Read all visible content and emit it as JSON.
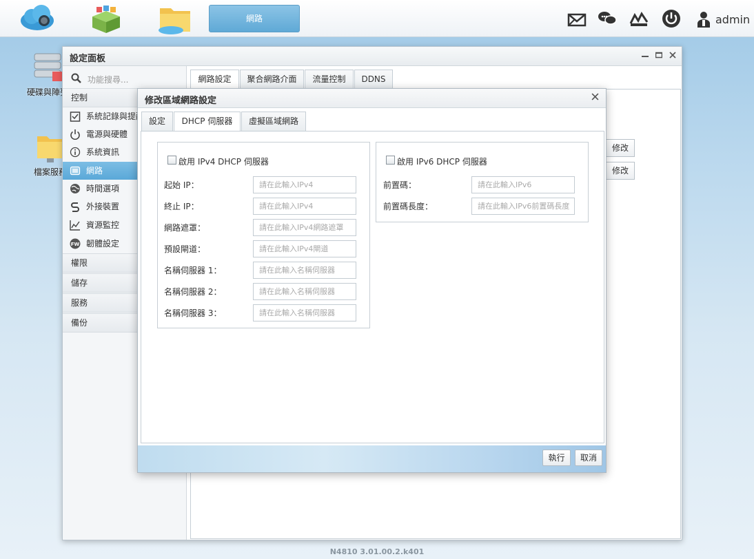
{
  "taskbar": {
    "active_app_label": "網路",
    "user_name": "admin",
    "icons": [
      "cloud-app-icon",
      "package-app-icon",
      "folder-app-icon",
      "message-icon",
      "chat-icon",
      "monitor-icon",
      "power-icon",
      "user-icon"
    ]
  },
  "desktop": {
    "icons": [
      {
        "label": "硬碟與陣列",
        "icon": "storage-icon"
      },
      {
        "label": "檔案服務",
        "icon": "file-service-icon"
      }
    ]
  },
  "window": {
    "title": "設定面板",
    "search_placeholder": "功能搜尋...",
    "sidebar": {
      "section_control": "控制",
      "items": [
        {
          "label": "系統記錄與提醒",
          "icon": "checklist-icon"
        },
        {
          "label": "電源與硬體",
          "icon": "power-icon"
        },
        {
          "label": "系統資訊",
          "icon": "info-icon"
        },
        {
          "label": "網路",
          "icon": "network-icon"
        },
        {
          "label": "時間選項",
          "icon": "globe-icon"
        },
        {
          "label": "外接裝置",
          "icon": "usb-icon"
        },
        {
          "label": "資源監控",
          "icon": "chart-icon"
        },
        {
          "label": "韌體設定",
          "icon": "firmware-icon"
        }
      ],
      "sections": [
        "權限",
        "儲存",
        "服務",
        "備份"
      ]
    },
    "tabs": [
      "網路設定",
      "聚合網路介面",
      "流量控制",
      "DDNS"
    ],
    "edit_buttons": [
      "修改",
      "修改"
    ]
  },
  "dialog": {
    "title": "修改區域網路設定",
    "tabs": [
      "設定",
      "DHCP 伺服器",
      "虛擬區域網路"
    ],
    "ipv4": {
      "legend": "啟用 IPv4 DHCP 伺服器",
      "fields": [
        {
          "label": "起始 IP：",
          "placeholder": "請在此輸入IPv4"
        },
        {
          "label": "終止 IP：",
          "placeholder": "請在此輸入IPv4"
        },
        {
          "label": "網路遮罩：",
          "placeholder": "請在此輸入IPv4網路遮罩"
        },
        {
          "label": "預設閘道：",
          "placeholder": "請在此輸入IPv4閘道"
        },
        {
          "label": "名稱伺服器 1：",
          "placeholder": "請在此輸入名稱伺服器"
        },
        {
          "label": "名稱伺服器 2：",
          "placeholder": "請在此輸入名稱伺服器"
        },
        {
          "label": "名稱伺服器 3：",
          "placeholder": "請在此輸入名稱伺服器"
        }
      ]
    },
    "ipv6": {
      "legend": "啟用 IPv6 DHCP 伺服器",
      "fields": [
        {
          "label": "前置碼：",
          "placeholder": "請在此輸入IPv6"
        },
        {
          "label": "前置碼長度：",
          "placeholder": "請在此輸入IPv6前置碼長度"
        }
      ]
    },
    "buttons": {
      "execute": "執行",
      "cancel": "取消"
    }
  },
  "version": "N4810   3.01.00.2.k401"
}
